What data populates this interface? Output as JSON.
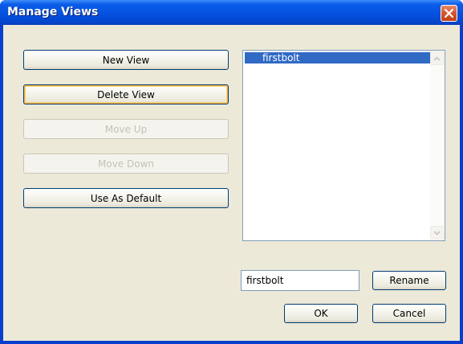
{
  "dialog": {
    "title": "Manage Views",
    "close_icon": "close-icon"
  },
  "buttons": {
    "new_view": "New View",
    "delete_view": "Delete View",
    "move_up": "Move Up",
    "move_down": "Move Down",
    "use_as_default": "Use As Default",
    "rename": "Rename",
    "ok": "OK",
    "cancel": "Cancel"
  },
  "views_list": {
    "items": [
      {
        "label": "firstbolt",
        "selected": true
      }
    ]
  },
  "name_field": {
    "value": "firstbolt"
  },
  "colors": {
    "titlebar": "#0a5ce8",
    "selection": "#316ac5",
    "dialog_face": "#ece9d8",
    "focus_ring": "#f8b33a"
  }
}
